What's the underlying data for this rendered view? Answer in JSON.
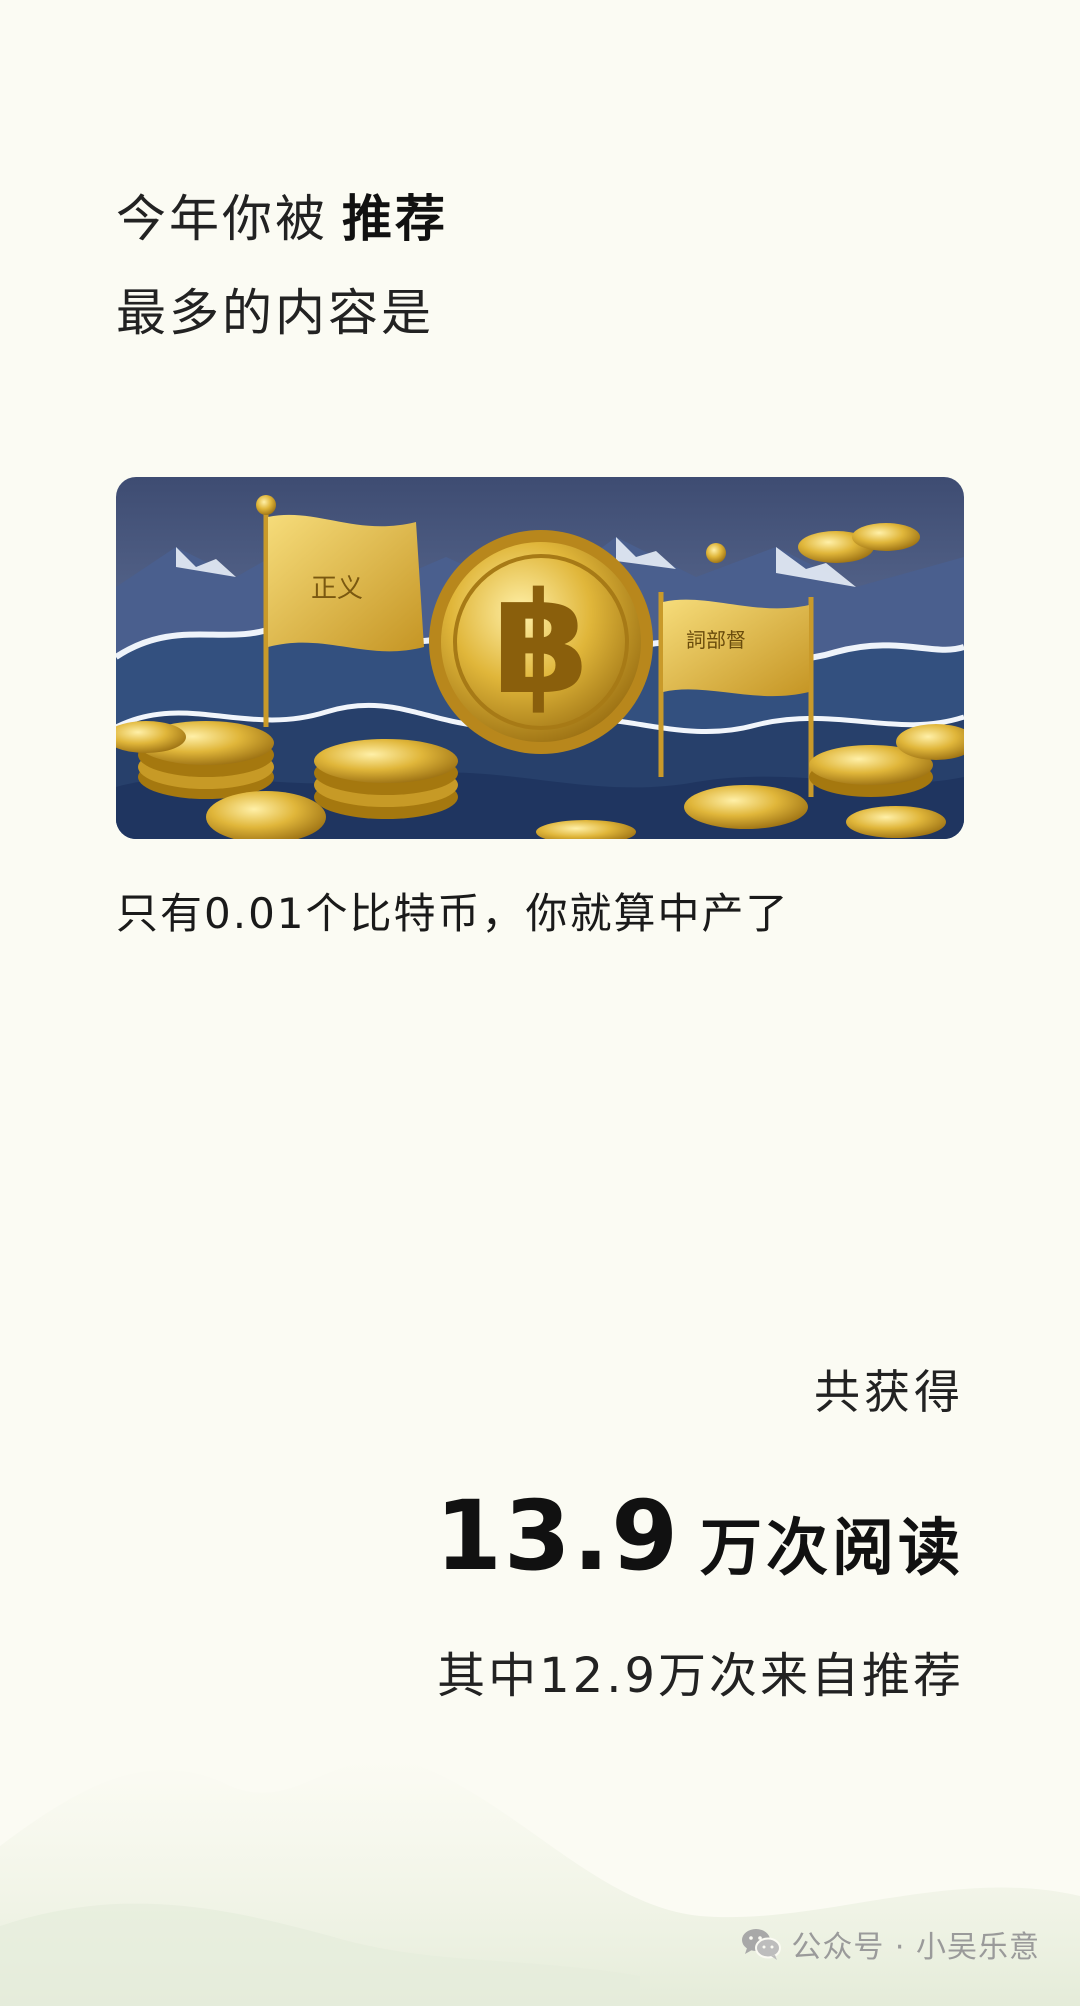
{
  "headline": {
    "prefix": "今年你被",
    "emphasis": "推荐",
    "line2": "最多的内容是"
  },
  "article": {
    "cover_image": "bitcoin-coins-waves-illustration",
    "title": "只有0.01个比特币，你就算中产了"
  },
  "stats": {
    "label": "共获得",
    "reads_number": "13.9",
    "reads_unit": "万次阅读",
    "recommended_text": "其中12.9万次来自推荐"
  },
  "watermark": {
    "icon": "wechat-icon",
    "text": "公众号 · 小吴乐意"
  },
  "colors": {
    "background": "#fbfbf3",
    "gold": "#d4a92c",
    "wave_blue": "#3e5a92"
  }
}
